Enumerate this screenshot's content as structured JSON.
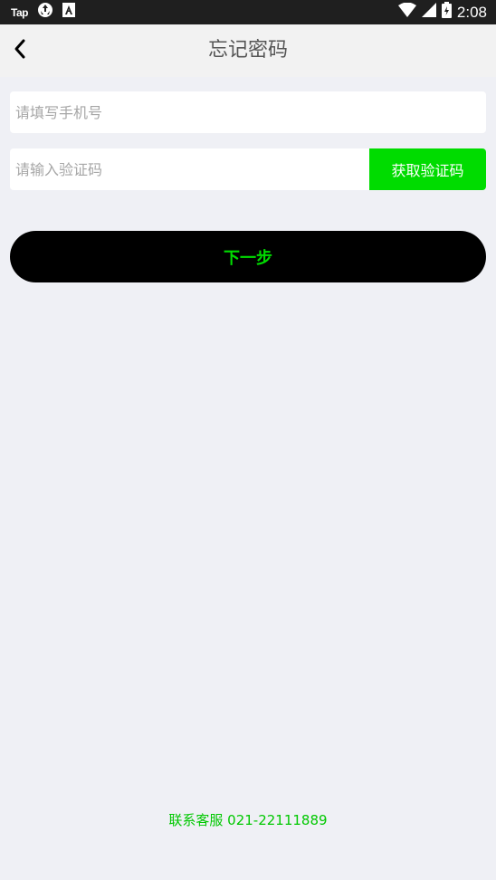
{
  "status_bar": {
    "app_label": "Tap",
    "time": "2:08",
    "icons": [
      "tap-icon",
      "sync-icon",
      "font-app-icon",
      "wifi-icon",
      "signal-icon",
      "battery-icon"
    ]
  },
  "header": {
    "title": "忘记密码",
    "back_icon": "chevron-left-icon"
  },
  "form": {
    "phone_placeholder": "请填写手机号",
    "phone_value": "",
    "code_placeholder": "请输入验证码",
    "code_value": "",
    "get_code_label": "获取验证码"
  },
  "next_label": "下一步",
  "contact_text": "联系客服 021-22111889",
  "colors": {
    "accent": "#00dc00",
    "page_background": "#eff0f5",
    "header_background": "#f2f2f2",
    "status_bar": "#1f1f1f",
    "button_dark": "#000000"
  }
}
